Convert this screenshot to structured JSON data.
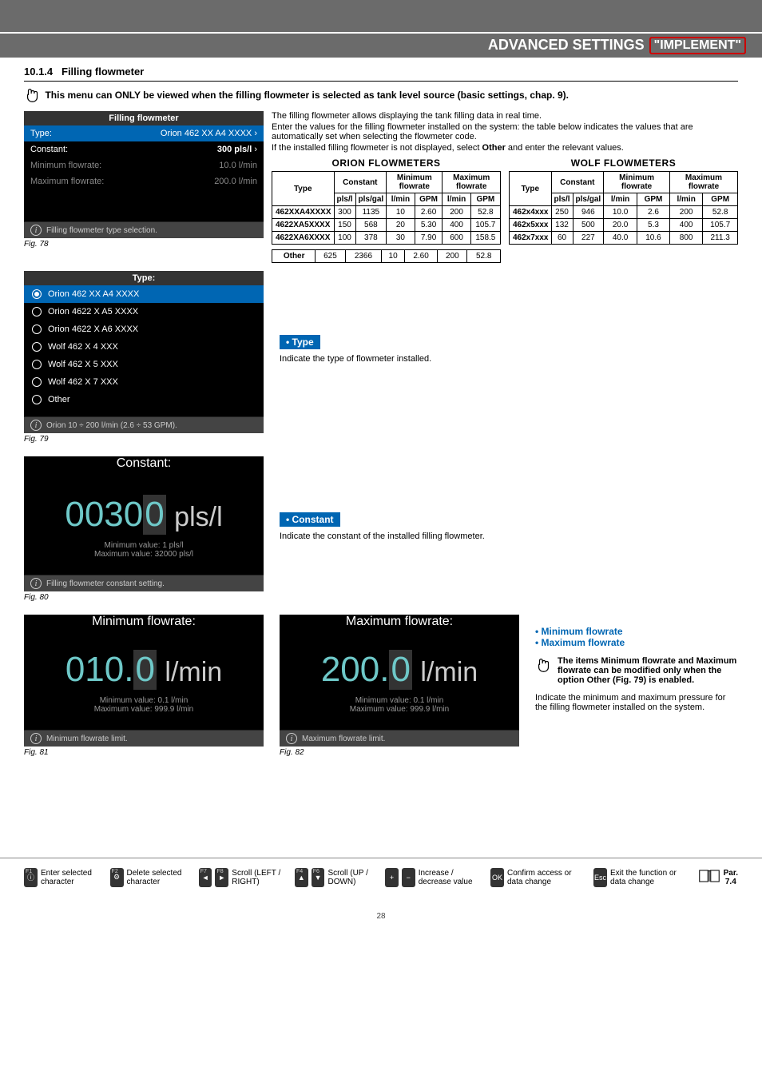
{
  "header": {
    "title": "ADVANCED SETTINGS",
    "pill": "\"IMPLEMENT\""
  },
  "section": {
    "num": "10.1.4",
    "title": "Filling flowmeter"
  },
  "warning": "This menu can ONLY be viewed when the filling flowmeter is selected as tank level source (basic settings, chap. 9).",
  "intro": {
    "l1": "The filling flowmeter allows displaying the tank filling data in real time.",
    "l2": "Enter the values for the filling flowmeter installed on the system: the table below indicates the values that are automatically set when selecting the flowmeter code.",
    "l3_a": "If the installed filling flowmeter is not displayed, select ",
    "l3_b": "Other",
    "l3_c": " and enter the relevant values."
  },
  "fig78": {
    "title": "Filling flowmeter",
    "type_label": "Type:",
    "type_val": "Orion 462 XX A4 XXXX",
    "const_label": "Constant:",
    "const_val": "300 pls/l",
    "min_label": "Minimum flowrate:",
    "min_val": "10.0 l/min",
    "max_label": "Maximum flowrate:",
    "max_val": "200.0 l/min",
    "info": "Filling flowmeter type selection.",
    "cap": "Fig. 78"
  },
  "orion": {
    "head": "ORION FLOWMETERS",
    "cols": {
      "type": "Type",
      "const": "Constant",
      "min": "Minimum flowrate",
      "max": "Maximum flowrate",
      "u1": "pls/l",
      "u2": "pls/gal",
      "u3": "l/min",
      "u4": "GPM",
      "u5": "l/min",
      "u6": "GPM"
    },
    "rows": [
      {
        "t": "462XXA4XXXX",
        "c1": "300",
        "c2": "1135",
        "m1": "10",
        "m2": "2.60",
        "x1": "200",
        "x2": "52.8"
      },
      {
        "t": "4622XA5XXXX",
        "c1": "150",
        "c2": "568",
        "m1": "20",
        "m2": "5.30",
        "x1": "400",
        "x2": "105.7"
      },
      {
        "t": "4622XA6XXXX",
        "c1": "100",
        "c2": "378",
        "m1": "30",
        "m2": "7.90",
        "x1": "600",
        "x2": "158.5"
      }
    ],
    "other": {
      "t": "Other",
      "c1": "625",
      "c2": "2366",
      "m1": "10",
      "m2": "2.60",
      "x1": "200",
      "x2": "52.8"
    }
  },
  "wolf": {
    "head": "WOLF FLOWMETERS",
    "cols": {
      "type": "Type",
      "const": "Constant",
      "min": "Minimum flowrate",
      "max": "Maximum flowrate",
      "u1": "pls/l",
      "u2": "pls/gal",
      "u3": "l/min",
      "u4": "GPM",
      "u5": "l/min",
      "u6": "GPM"
    },
    "rows": [
      {
        "t": "462x4xxx",
        "c1": "250",
        "c2": "946",
        "m1": "10.0",
        "m2": "2.6",
        "x1": "200",
        "x2": "52.8"
      },
      {
        "t": "462x5xxx",
        "c1": "132",
        "c2": "500",
        "m1": "20.0",
        "m2": "5.3",
        "x1": "400",
        "x2": "105.7"
      },
      {
        "t": "462x7xxx",
        "c1": "60",
        "c2": "227",
        "m1": "40.0",
        "m2": "10.6",
        "x1": "800",
        "x2": "211.3"
      }
    ]
  },
  "fig79": {
    "title": "Type:",
    "items": [
      "Orion 462 XX A4 XXXX",
      "Orion 4622 X A5 XXXX",
      "Orion 4622 X A6 XXXX",
      "Wolf 462 X 4 XXX",
      "Wolf 462 X 5 XXX",
      "Wolf 462 X 7 XXX",
      "Other"
    ],
    "info": "Orion 10 ÷ 200 l/min (2.6 ÷ 53 GPM).",
    "cap": "Fig. 79"
  },
  "type_sec": {
    "label": "• Type",
    "text": "Indicate the type of flowmeter installed."
  },
  "fig80": {
    "title": "Constant:",
    "num_pre": "0030",
    "num_cur": "0",
    "unit": "pls/l",
    "min": "Minimum value:  1 pls/l",
    "max": "Maximum value:  32000 pls/l",
    "info": "Filling flowmeter constant setting.",
    "cap": "Fig. 80"
  },
  "const_sec": {
    "label": "• Constant",
    "text": "Indicate the constant of the installed filling flowmeter."
  },
  "fig81": {
    "title": "Minimum flowrate:",
    "num_pre": "010.",
    "num_cur": "0",
    "unit": "l/min",
    "min": "Minimum value:  0.1 l/min",
    "max": "Maximum value:  999.9 l/min",
    "info": "Minimum flowrate limit.",
    "cap": "Fig. 81"
  },
  "fig82": {
    "title": "Maximum flowrate:",
    "num_pre": "200.",
    "num_cur": "0",
    "unit": "l/min",
    "min": "Minimum value:  0.1 l/min",
    "max": "Maximum value:  999.9 l/min",
    "info": "Maximum flowrate limit.",
    "cap": "Fig. 82"
  },
  "flowrate_block": {
    "h1": "• Minimum flowrate",
    "h2": "• Maximum flowrate",
    "note_a": "The items ",
    "note_b": "Minimum flowrate",
    "note_c": " and ",
    "note_d": "Maximum flowrate",
    "note_e": " can be modified only when the option ",
    "note_f": "Other",
    "note_g": " (Fig. 79) is enabled.",
    "after": "Indicate the minimum and maximum pressure for the filling flowmeter installed on the system."
  },
  "footer": {
    "f1": {
      "k": "F1",
      "d": "Enter selected character"
    },
    "f2": {
      "k": "F2",
      "d": "Delete selected character"
    },
    "f78": {
      "d": "Scroll (LEFT / RIGHT)"
    },
    "f46": {
      "d": "Scroll (UP / DOWN)"
    },
    "pm": {
      "d": "Increase / decrease value"
    },
    "ok": {
      "k": "OK",
      "d": "Confirm access or data change"
    },
    "esc": {
      "k": "Esc",
      "d": "Exit the function or data change"
    },
    "par": {
      "h": "Par.",
      "n": "7.4"
    }
  },
  "page": "28"
}
